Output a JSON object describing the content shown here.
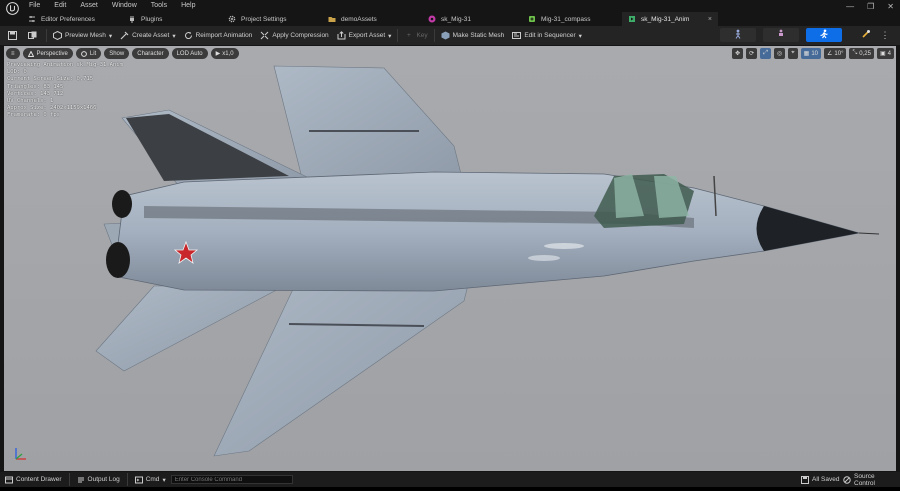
{
  "menu": {
    "logo_icon": "unreal-logo-icon",
    "items": [
      "File",
      "Edit",
      "Asset",
      "Window",
      "Tools",
      "Help"
    ]
  },
  "window_controls": {
    "minimize": "—",
    "restore": "❐",
    "close": "✕"
  },
  "tabs": [
    {
      "label": "Editor Preferences",
      "icon": "sliders-icon",
      "active": false
    },
    {
      "label": "Plugins",
      "icon": "plug-icon",
      "active": false
    },
    {
      "label": "Project Settings",
      "icon": "gear-icon",
      "active": false
    },
    {
      "label": "demoAssets",
      "icon": "folder-icon",
      "active": false
    },
    {
      "label": "sk_Mig-31",
      "icon": "skeletal-mesh-icon",
      "active": false
    },
    {
      "label": "Mig-31_compass",
      "icon": "skeleton-icon",
      "active": false
    },
    {
      "label": "sk_Mig-31_Anim",
      "icon": "animation-icon",
      "active": true,
      "close": "×"
    }
  ],
  "toolbar": {
    "save_icon": "save-icon",
    "browse_icon": "browse-icon",
    "preview_mesh": "Preview Mesh",
    "create_asset": "Create Asset",
    "reimport_animation": "Reimport Animation",
    "apply_compression": "Apply Compression",
    "export_asset": "Export Asset",
    "key": "Key",
    "make_static_mesh": "Make Static Mesh",
    "edit_in_sequencer": "Edit in Sequencer"
  },
  "viewport": {
    "chips": {
      "perspective": "Perspective",
      "lit": "Lit",
      "show": "Show",
      "character": "Character",
      "lod": "LOD Auto",
      "speed": "x1,0"
    },
    "right_controls": {
      "grid_snap": "10",
      "rotation_snap": "10°",
      "scale_snap": "0,25",
      "camera_speed": "4"
    },
    "stats": [
      "Previewing Animation sk_Mig-31_Anim",
      "LOD: 0",
      "Current Screen Size: 0,715",
      "Triangles: 83 145",
      "Vertices: 143 712",
      "UV Channels: 1",
      "Approx Size: 2402x1159x1466",
      "Framerate: 0 fps"
    ],
    "colors": {
      "background": "#a4a6aa",
      "fuselage": "#a7b3c2",
      "star": "#c8262a"
    }
  },
  "statusbar": {
    "content_drawer": "Content Drawer",
    "output_log": "Output Log",
    "cmd": "Cmd",
    "cmd_placeholder": "Enter Console Command",
    "all_saved": "All Saved",
    "source_control": "Source Control"
  }
}
